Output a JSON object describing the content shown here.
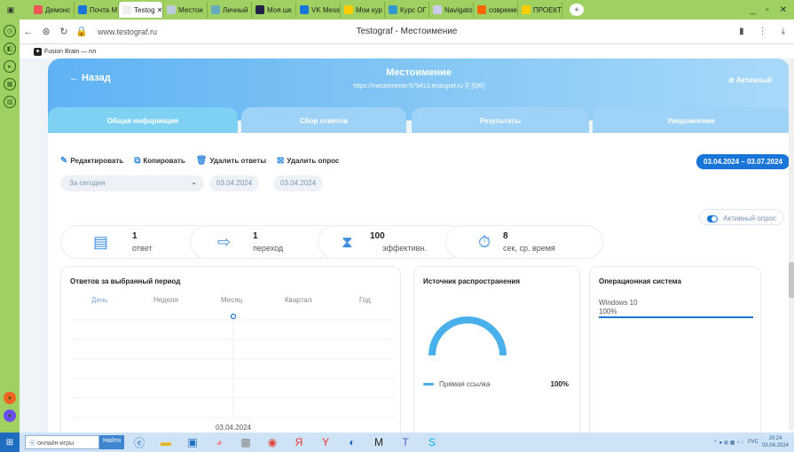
{
  "browser": {
    "tabs": [
      {
        "label": "Демонс",
        "color": "#e55"
      },
      {
        "label": "Почта М",
        "color": "#1a75d8"
      },
      {
        "label": "Testog ✕",
        "color": "#eee",
        "active": true
      },
      {
        "label": "Местои",
        "color": "#bcd"
      },
      {
        "label": "Личный",
        "color": "#6ab"
      },
      {
        "label": "Моя шк",
        "color": "#224"
      },
      {
        "label": "VK Mess",
        "color": "#1a75d8"
      },
      {
        "label": "Мои кур",
        "color": "#fc0"
      },
      {
        "label": "Курс ОГ",
        "color": "#39c"
      },
      {
        "label": "Navigato",
        "color": "#cce"
      },
      {
        "label": "совреме",
        "color": "#f60"
      },
      {
        "label": "ПРОЕКТ",
        "color": "#fc0"
      }
    ],
    "url": "www.testograf.ru",
    "page_title": "Testograf - Местоимение",
    "bookmark": "Fusion Brain — пл"
  },
  "hero": {
    "back_label": "← Назад",
    "title": "Местоимение",
    "survey_url": "https://mestoimenie-579413.testograf.ru",
    "qr_label": "[QR]",
    "status": "Активный"
  },
  "tabs": [
    "Общая информация",
    "Сбор ответов",
    "Результаты",
    "Уведомления"
  ],
  "actions": {
    "edit": "Редактировать",
    "copy": "Копировать",
    "delete_answers": "Удалить ответы",
    "delete_survey": "Удалить опрос"
  },
  "date_range": "03.04.2024 – 03.07.2024",
  "filter": {
    "period": "За сегодня",
    "date_from": "03.04.2024",
    "date_to": "03.04.2024"
  },
  "active_toggle_label": "Активный опрос",
  "stats": [
    {
      "num": "1",
      "label": "ответ",
      "icon": "form-icon"
    },
    {
      "num": "1",
      "label": "переход",
      "icon": "arrow-right-icon"
    },
    {
      "num": "100",
      "label": "эффективн.",
      "icon": "hourglass-icon"
    },
    {
      "num": "8",
      "label": "сек, ср. время",
      "icon": "stopwatch-icon"
    }
  ],
  "answers_card": {
    "title": "Ответов за выбранный период",
    "periods": [
      "День",
      "Неделя",
      "Месяц",
      "Квартал",
      "Год"
    ],
    "active_period": "День",
    "x_label": "03.04.2024"
  },
  "chart_data": {
    "type": "line",
    "categories": [
      "03.04.2024"
    ],
    "values": [
      1
    ],
    "title": "Ответов за выбранный период"
  },
  "source_card": {
    "title": "Источник распространения",
    "legend": "Прямая ссылка",
    "percent": "100%",
    "accent": "#4ab0ec"
  },
  "os_card": {
    "title": "Операционная система",
    "os": "Windows 10",
    "percent": "100%",
    "accent": "#1a75d8"
  },
  "taskbar": {
    "search_placeholder": "онлайн-игры",
    "find_label": "Найти",
    "lang": "РУС",
    "time": "20:24",
    "date": "03.04.2024"
  }
}
